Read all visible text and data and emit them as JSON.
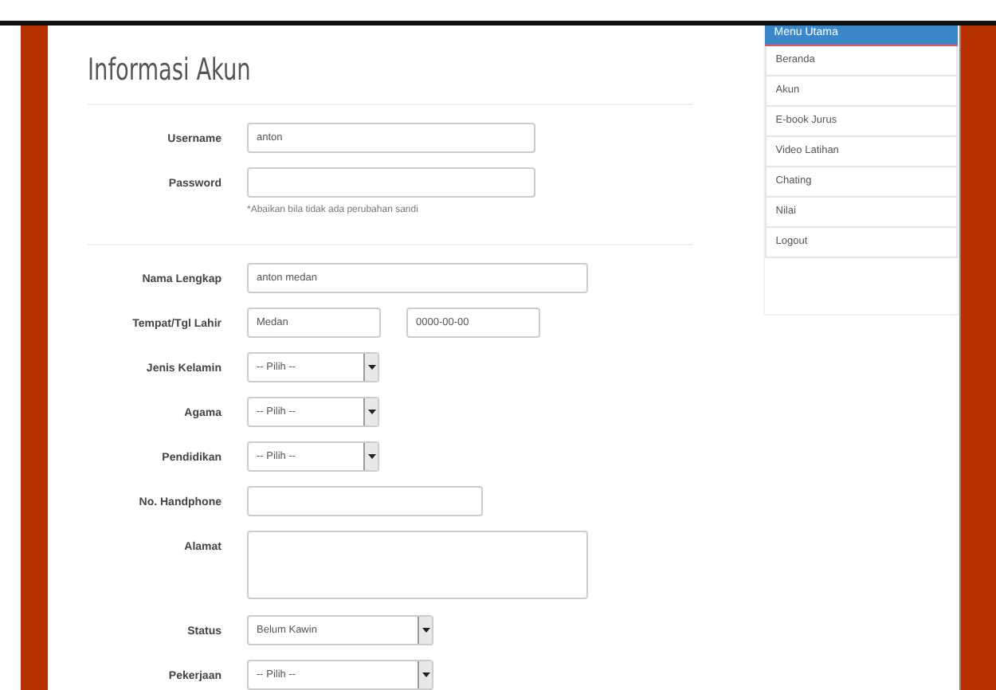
{
  "page_title": "Informasi Akun",
  "account_fields": [
    {
      "label": "Username",
      "kind": "text",
      "value": "anton"
    },
    {
      "label": "Password",
      "kind": "text",
      "hint": "*Abaikan bila tidak ada perubahan sandi"
    }
  ],
  "profile_fields": [
    {
      "label": "Nama Lengkap",
      "kind": "text",
      "value": "anton medan"
    },
    {
      "label": "Tempat/Tgl Lahir",
      "kind": "pair",
      "value": "Medan",
      "value2": "0000-00-00"
    },
    {
      "label": "Jenis Kelamin",
      "kind": "select",
      "value": "-- Pilih --"
    },
    {
      "label": "Agama",
      "kind": "select",
      "value": "-- Pilih --"
    },
    {
      "label": "Pendidikan",
      "kind": "select",
      "value": "-- Pilih --"
    },
    {
      "label": "No. Handphone",
      "kind": "text"
    },
    {
      "label": "Alamat",
      "kind": "textarea"
    },
    {
      "label": "Status",
      "kind": "select",
      "value": "Belum Kawin"
    },
    {
      "label": "Pekerjaan",
      "kind": "select",
      "value": "-- Pilih --"
    }
  ],
  "sidebar": {
    "title": "Menu Utama",
    "items": [
      "Beranda",
      "Akun",
      "E-book Jurus",
      "Video Latihan",
      "Chating",
      "Nilai",
      "Logout"
    ]
  }
}
